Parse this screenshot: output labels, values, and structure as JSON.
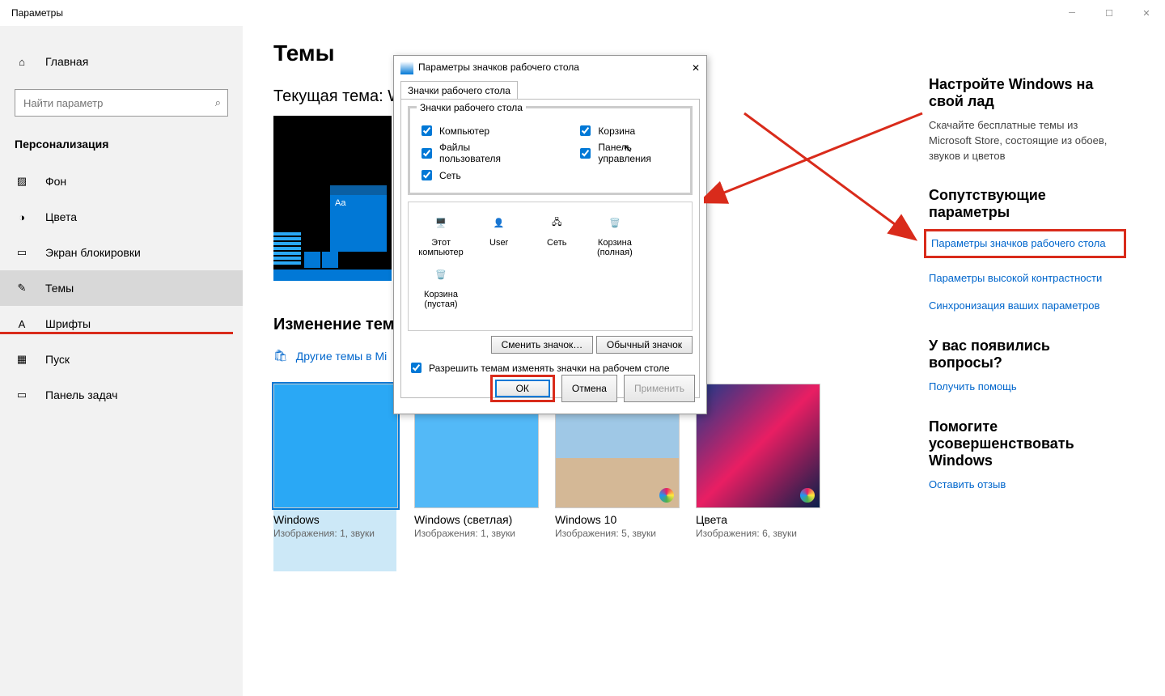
{
  "window": {
    "title": "Параметры"
  },
  "sidebar": {
    "home": "Главная",
    "search_placeholder": "Найти параметр",
    "section": "Персонализация",
    "items": [
      "Фон",
      "Цвета",
      "Экран блокировки",
      "Темы",
      "Шрифты",
      "Пуск",
      "Панель задач"
    ],
    "active_index": 3
  },
  "main": {
    "h1": "Темы",
    "current_theme_prefix": "Текущая тема: W",
    "change_heading": "Изменение темы",
    "more_themes": "Другие темы в Mi",
    "themes": [
      {
        "name": "Windows",
        "sub": "Изображения: 1, звуки"
      },
      {
        "name": "Windows (светлая)",
        "sub": "Изображения: 1, звуки"
      },
      {
        "name": "Windows 10",
        "sub": "Изображения: 5, звуки"
      },
      {
        "name": "Цвета",
        "sub": "Изображения: 6, звуки"
      }
    ]
  },
  "right": {
    "h1": "Настройте Windows на свой лад",
    "txt1": "Скачайте бесплатные темы из Microsoft Store, состоящие из обоев, звуков и цветов",
    "h2": "Сопутствующие параметры",
    "link1": "Параметры значков рабочего стола",
    "link2": "Параметры высокой контрастности",
    "link3": "Синхронизация ваших параметров",
    "h3": "У вас появились вопросы?",
    "link4": "Получить помощь",
    "h4": "Помогите усовершенствовать Windows",
    "link5": "Оставить отзыв"
  },
  "dialog": {
    "title": "Параметры значков рабочего стола",
    "tab": "Значки рабочего стола",
    "group_legend": "Значки рабочего стола",
    "checks": {
      "computer": "Компьютер",
      "user_files": "Файлы пользователя",
      "network": "Сеть",
      "recycle": "Корзина",
      "control_panel": "Панель управления"
    },
    "icons": [
      {
        "label": "Этот компьютер"
      },
      {
        "label": "User"
      },
      {
        "label": "Сеть"
      },
      {
        "label": "Корзина (полная)"
      },
      {
        "label": "Корзина (пустая)"
      }
    ],
    "change_icon": "Сменить значок…",
    "default_icon": "Обычный значок",
    "allow_themes": "Разрешить темам изменять значки на рабочем столе",
    "ok": "ОК",
    "cancel": "Отмена",
    "apply": "Применить"
  }
}
